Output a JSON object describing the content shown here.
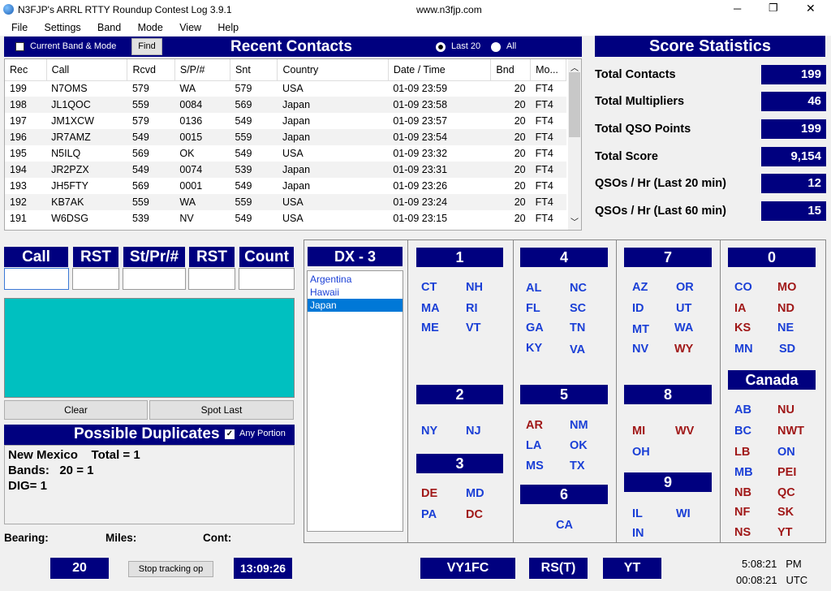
{
  "window": {
    "title": "N3FJP's ARRL RTTY Roundup Contest Log 3.9.1",
    "url": "www.n3fjp.com",
    "minimize": "─",
    "maximize": "❐",
    "close": "✕"
  },
  "menu": [
    "File",
    "Settings",
    "Band",
    "Mode",
    "View",
    "Help"
  ],
  "recent": {
    "checkbox_label": "Current Band & Mode",
    "find_label": "Find",
    "title": "Recent Contacts",
    "radio1": "Last 20",
    "radio2": "All",
    "headers": [
      "Rec",
      "Call",
      "Rcvd",
      "S/P/#",
      "Snt",
      "Country",
      "Date   /   Time",
      "Bnd",
      "Mo..."
    ],
    "rows": [
      [
        "199",
        "N7OMS",
        "579",
        "WA",
        "579",
        "USA",
        "01-09  23:59",
        "20",
        "FT4"
      ],
      [
        "198",
        "JL1QOC",
        "559",
        "0084",
        "569",
        "Japan",
        "01-09  23:58",
        "20",
        "FT4"
      ],
      [
        "197",
        "JM1XCW",
        "579",
        "0136",
        "549",
        "Japan",
        "01-09  23:57",
        "20",
        "FT4"
      ],
      [
        "196",
        "JR7AMZ",
        "549",
        "0015",
        "559",
        "Japan",
        "01-09  23:54",
        "20",
        "FT4"
      ],
      [
        "195",
        "N5ILQ",
        "569",
        "OK",
        "549",
        "USA",
        "01-09  23:32",
        "20",
        "FT4"
      ],
      [
        "194",
        "JR2PZX",
        "549",
        "0074",
        "539",
        "Japan",
        "01-09  23:31",
        "20",
        "FT4"
      ],
      [
        "193",
        "JH5FTY",
        "569",
        "0001",
        "549",
        "Japan",
        "01-09  23:26",
        "20",
        "FT4"
      ],
      [
        "192",
        "KB7AK",
        "559",
        "WA",
        "559",
        "USA",
        "01-09  23:24",
        "20",
        "FT4"
      ],
      [
        "191",
        "W6DSG",
        "539",
        "NV",
        "549",
        "USA",
        "01-09  23:15",
        "20",
        "FT4"
      ]
    ]
  },
  "score": {
    "title": "Score Statistics",
    "items": [
      {
        "label": "Total Contacts",
        "value": "199"
      },
      {
        "label": "Total Multipliers",
        "value": "46"
      },
      {
        "label": "Total QSO Points",
        "value": "199"
      },
      {
        "label": "Total Score",
        "value": "9,154"
      },
      {
        "label": "QSOs / Hr (Last 20 min)",
        "value": "12"
      },
      {
        "label": "QSOs / Hr (Last 60 min)",
        "value": "15"
      }
    ]
  },
  "entry": {
    "call": "Call",
    "rst1": "RST",
    "stpr": "St/Pr/#",
    "rst2": "RST",
    "count": "Count"
  },
  "buttons": {
    "clear": "Clear",
    "spot_last": "Spot Last",
    "stop_tracking": "Stop tracking op"
  },
  "dup": {
    "title": "Possible Duplicates",
    "any_portion": "Any Portion",
    "lines": [
      "New Mexico    Total = 1",
      "Bands:   20 = 1",
      "DIG= 1"
    ]
  },
  "bearing": {
    "bearing": "Bearing:",
    "miles": "Miles:",
    "cont": "Cont:"
  },
  "dx": {
    "title": "DX - 3",
    "items": [
      "Argentina",
      "Hawaii",
      "Japan"
    ]
  },
  "districts": {
    "d1": "1",
    "d2": "2",
    "d3": "3",
    "d4": "4",
    "d5": "5",
    "d6": "6",
    "d7": "7",
    "d8": "8",
    "d9": "9",
    "d0": "0",
    "canada": "Canada"
  },
  "colors": {
    "worked": "#1a3fd6",
    "needed": "#a01818",
    "navy": "#00007f",
    "entry": "#00c0c0"
  },
  "status": {
    "band": "20",
    "time": "13:09:26",
    "call": "VY1FC",
    "rst": "RS(T)",
    "state": "YT",
    "local": "5:08:21   PM",
    "utc": "00:08:21   UTC"
  }
}
